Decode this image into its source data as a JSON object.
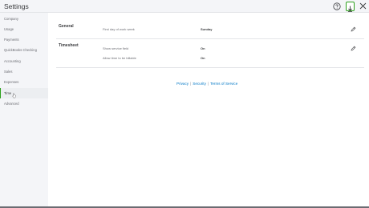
{
  "header": {
    "title": "Settings",
    "icons": [
      "help-icon",
      "active-section-icon",
      "close-icon"
    ]
  },
  "sidebar": {
    "items": [
      {
        "label": "Company"
      },
      {
        "label": "Usage"
      },
      {
        "label": "Payments"
      },
      {
        "label": "QuickBooks Checking"
      },
      {
        "label": "Accounting"
      },
      {
        "label": "Sales"
      },
      {
        "label": "Expenses"
      },
      {
        "label": "Time"
      },
      {
        "label": "Advanced"
      }
    ],
    "active_item": "Time"
  },
  "sections": {
    "general": {
      "title": "General",
      "fields": [
        {
          "label": "First day of work week",
          "value": "Sunday"
        }
      ]
    },
    "timesheet": {
      "title": "Timesheet",
      "fields": [
        {
          "label": "Show service field",
          "value": "On"
        },
        {
          "label": "Allow time to be billable",
          "value": "On"
        }
      ]
    }
  },
  "footer": {
    "privacy": "Privacy",
    "security": "Security",
    "terms": "Terms of Service",
    "separator": "|"
  },
  "colors": {
    "accent": "#2ca01c",
    "link": "#0077c5",
    "sidebar_bg": "#f4f5f8"
  }
}
